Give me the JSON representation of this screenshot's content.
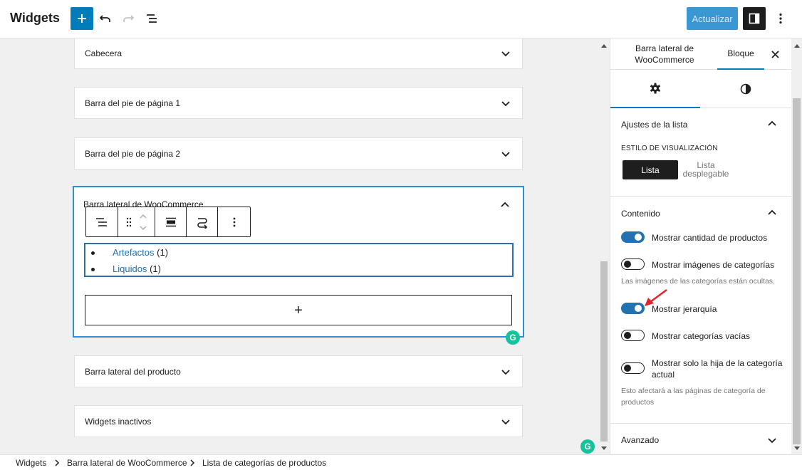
{
  "header": {
    "title": "Widgets",
    "update_label": "Actualizar",
    "icons": {
      "add": "plus-icon",
      "undo": "undo-icon",
      "redo": "redo-icon",
      "outline": "list-view-icon",
      "settings": "sidebar-toggle-icon",
      "more": "more-vertical-icon"
    }
  },
  "widget_areas": [
    {
      "title": "Cabecera",
      "expanded": false
    },
    {
      "title": "Barra del pie de página 1",
      "expanded": false
    },
    {
      "title": "Barra del pie de página 2",
      "expanded": false
    },
    {
      "title": "Barra lateral de WooCommerce",
      "expanded": true
    },
    {
      "title": "Barra lateral del producto",
      "expanded": false
    },
    {
      "title": "Widgets inactivos",
      "expanded": false
    }
  ],
  "category_block": {
    "items": [
      {
        "name": "Artefactos",
        "count": "(1)"
      },
      {
        "name": "Liquidos",
        "count": "(1)"
      }
    ],
    "appender_label": "+"
  },
  "sidebar": {
    "tab_area": "Barra lateral de WooCommerce",
    "tab_block": "Bloque",
    "list_settings": {
      "title": "Ajustes de la lista",
      "style_label": "ESTILO DE VISUALIZACIÓN",
      "option_list": "Lista",
      "option_dropdown": "Lista desplegable"
    },
    "content": {
      "title": "Contenido",
      "toggles": [
        {
          "label": "Mostrar cantidad de productos",
          "on": true
        },
        {
          "label": "Mostrar imágenes de categorías",
          "on": false
        },
        {
          "label": "Mostrar jerarquía",
          "on": true
        },
        {
          "label": "Mostrar categorías vacías",
          "on": false
        },
        {
          "label": "Mostrar solo la hija de la categoría actual",
          "on": false
        }
      ],
      "help_images": "Las imágenes de las categorías están ocultas.",
      "help_child": "Esto afectará a las páginas de categoría de productos"
    },
    "advanced": {
      "title": "Avanzado"
    }
  },
  "breadcrumb": [
    "Widgets",
    "Barra lateral de WooCommerce",
    "Lista de categorías de productos"
  ],
  "colors": {
    "accent": "#007cba",
    "selection": "#2f8fd1",
    "annotation_arrow": "#e0242b"
  }
}
